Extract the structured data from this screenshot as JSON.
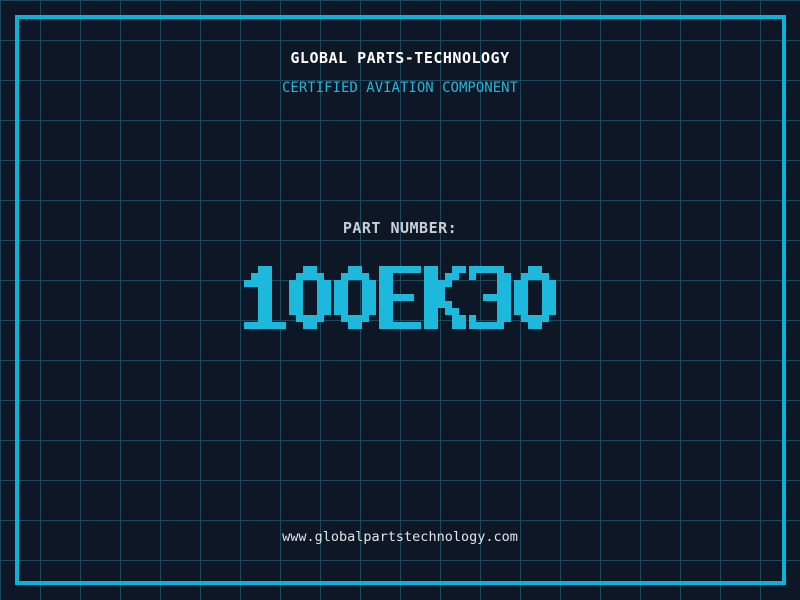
{
  "header": {
    "company": "GLOBAL PARTS-TECHNOLOGY",
    "tagline": "CERTIFIED AVIATION COMPONENT"
  },
  "part": {
    "label": "PART NUMBER:",
    "number": "100EK30"
  },
  "footer": {
    "website": "www.globalpartstechnology.com"
  },
  "colors": {
    "background": "#0e1726",
    "grid_line": "#1b4a60",
    "frame": "#0ab2d8",
    "part_number": "#1cb9dd",
    "company": "#ffffff",
    "tagline": "#2bb3d6",
    "label": "#c8d0d6",
    "website": "#e0e5e9"
  }
}
